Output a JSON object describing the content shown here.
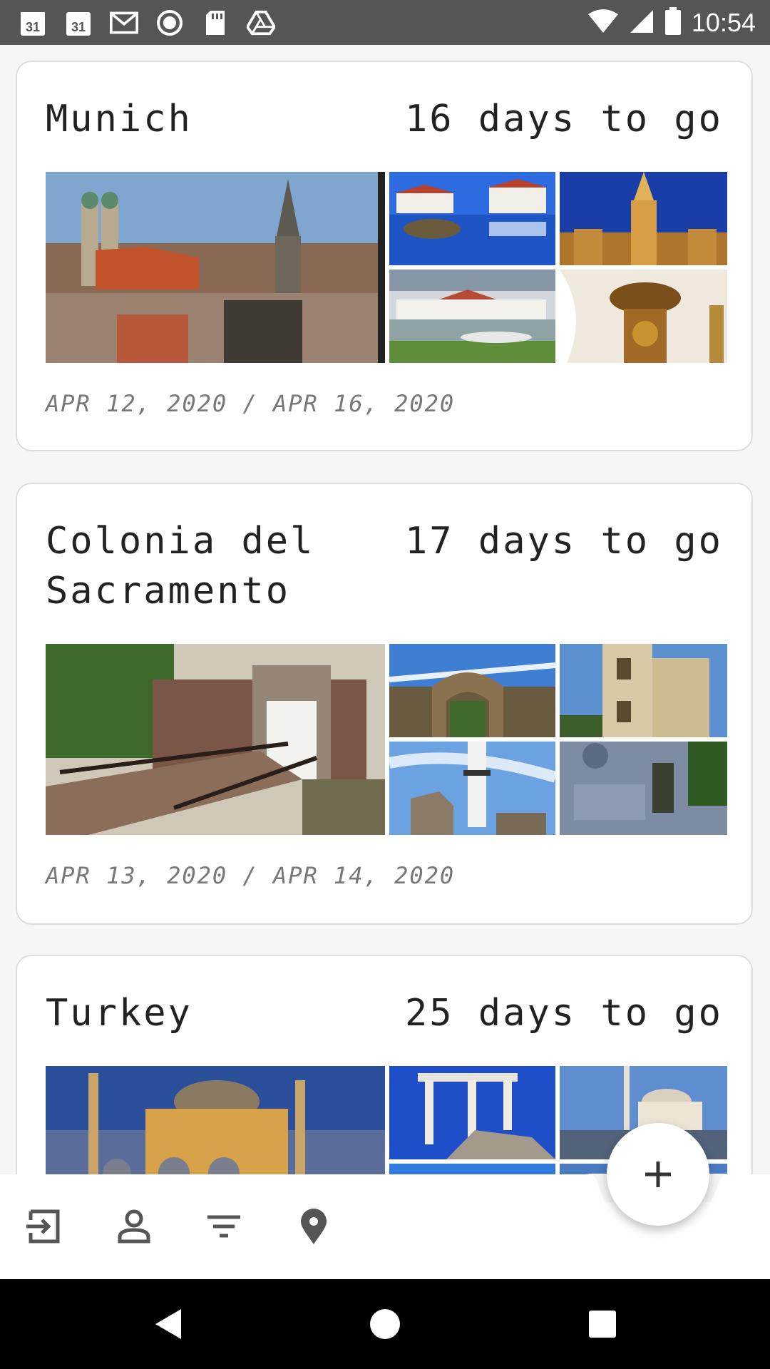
{
  "status_bar": {
    "time": "10:54",
    "left_icons": [
      "calendar-31-icon",
      "calendar-31-icon",
      "gmail-icon",
      "record-icon",
      "sd-card-icon",
      "drive-icon"
    ],
    "calendar_day": "31"
  },
  "trips": [
    {
      "title": "Munich",
      "countdown": "16 days to go",
      "dates": "APR 12, 2020 / APR 16, 2020"
    },
    {
      "title": "Colonia del Sacramento",
      "countdown": "17 days to go",
      "dates": "APR 13, 2020 / APR 14, 2020"
    },
    {
      "title": "Turkey",
      "countdown": "25 days to go",
      "dates": ""
    }
  ],
  "bottom_bar": {
    "items": [
      "logout-icon",
      "person-icon",
      "filter-icon",
      "location-pin-icon"
    ],
    "fab": "add-icon"
  },
  "nav_bar": [
    "back-icon",
    "home-icon",
    "recents-icon"
  ]
}
